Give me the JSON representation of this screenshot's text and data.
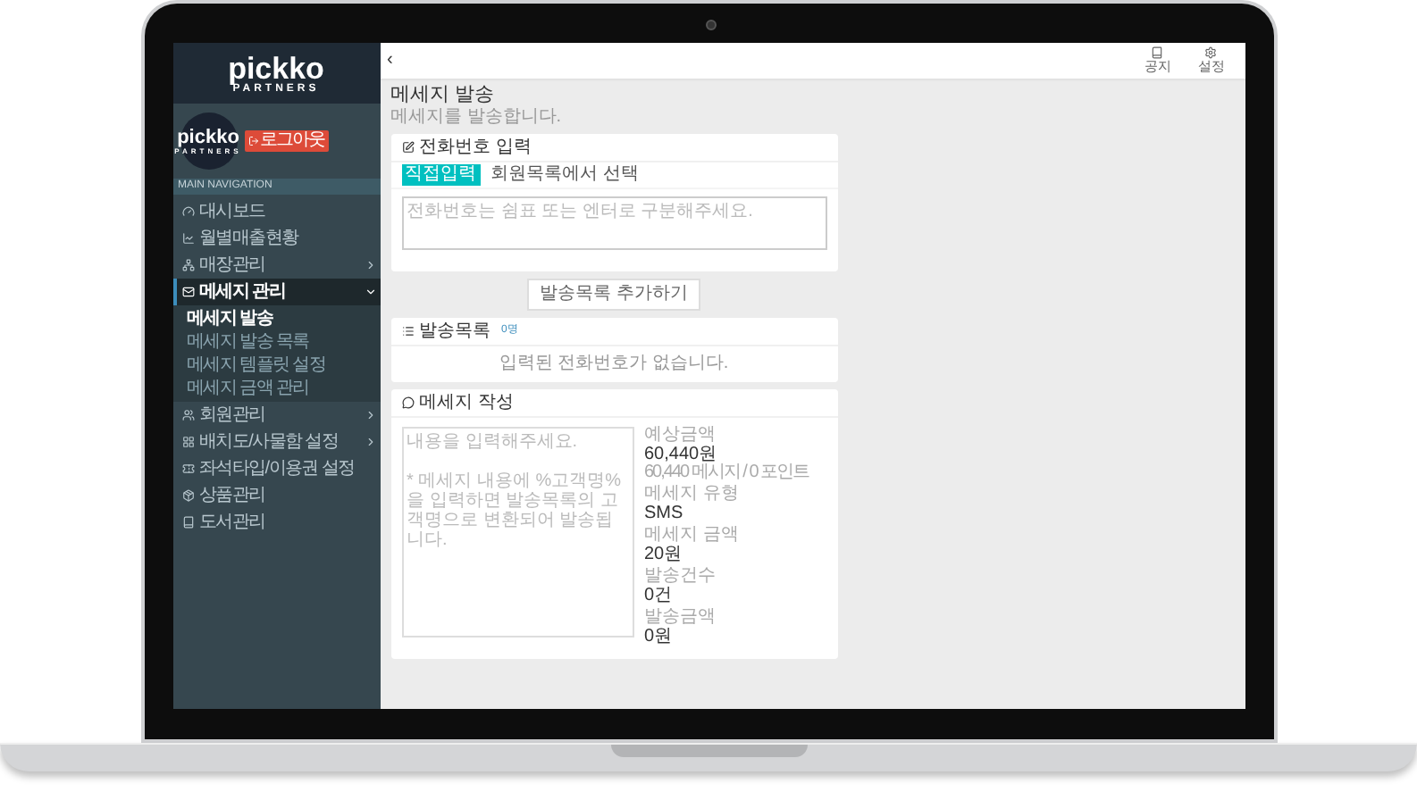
{
  "sidebar": {
    "logo": {
      "name": "pickko",
      "tagline": "PARTNERS"
    },
    "profile": {
      "avatar_name": "pickko",
      "avatar_tagline": "PARTNERS",
      "logout": "로그아웃"
    },
    "nav_label": "MAIN NAVIGATION",
    "items": [
      {
        "kind": "dashboard",
        "label": "대시보드",
        "has_children": false,
        "selected": false
      },
      {
        "kind": "chart",
        "label": "월별매출현황",
        "has_children": false,
        "selected": false
      },
      {
        "kind": "sitemap",
        "label": "매장관리",
        "has_children": true,
        "expanded": false,
        "selected": false
      },
      {
        "kind": "mail",
        "label": "메세지 관리",
        "has_children": true,
        "expanded": true,
        "selected": true,
        "children": [
          {
            "label": "메세지 발송",
            "selected": true
          },
          {
            "label": "메세지 발송 목록",
            "selected": false
          },
          {
            "label": "메세지 템플릿 설정",
            "selected": false
          },
          {
            "label": "메세지 금액 관리",
            "selected": false
          }
        ]
      },
      {
        "kind": "users",
        "label": "회원관리",
        "has_children": true,
        "expanded": false,
        "selected": false
      },
      {
        "kind": "grid",
        "label": "배치도/사물함 설정",
        "has_children": true,
        "expanded": false,
        "selected": false
      },
      {
        "kind": "ticket",
        "label": "좌석타입/이용권 설정",
        "has_children": false,
        "selected": false
      },
      {
        "kind": "box",
        "label": "상품관리",
        "has_children": false,
        "selected": false
      },
      {
        "kind": "book",
        "label": "도서관리",
        "has_children": false,
        "selected": false
      }
    ]
  },
  "header": {
    "toggle": "‹",
    "actions": [
      {
        "kind": "book",
        "label": "공지"
      },
      {
        "kind": "settings",
        "label": "설정"
      }
    ]
  },
  "page": {
    "title": "메세지 발송",
    "subtitle": "메세지를 발송합니다."
  },
  "phone_panel": {
    "title": "전화번호 입력",
    "tabs": [
      {
        "label": "직접입력",
        "selected": true
      },
      {
        "label": "회원목록에서 선택",
        "selected": false
      }
    ],
    "placeholder": "전화번호는 쉼표 또는 엔터로 구분해주세요."
  },
  "add_button": "발송목록 추가하기",
  "list_panel": {
    "title": "발송목록",
    "count": "0명",
    "empty": "입력된 전화번호가 없습니다."
  },
  "compose_panel": {
    "title": "메세지 작성",
    "placeholder": "내용을 입력해주세요.\n\n* 메세지 내용에 %고객명% 을 입력하면 발송목록의 고객명으로 변환되어 발송됩니다.",
    "stats": [
      {
        "label": "예상금액",
        "value": "60,440원",
        "note": "60,440 메시지 / 0 포인트"
      },
      {
        "label": "메세지 유형",
        "value": "SMS"
      },
      {
        "label": "메세지 금액",
        "value": "20원"
      },
      {
        "label": "발송건수",
        "value": "0건"
      },
      {
        "label": "발송금액",
        "value": "0원"
      }
    ]
  }
}
